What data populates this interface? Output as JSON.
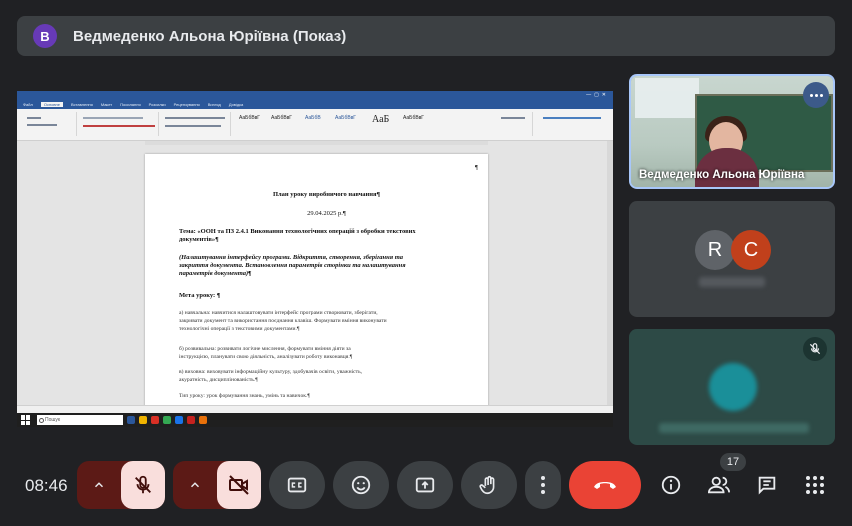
{
  "banner": {
    "avatar_letter": "В",
    "title": "Ведмеденко Альона Юріївна (Показ)"
  },
  "shared_screen": {
    "window_tabs": [
      "Файл",
      "Основне",
      "Вставлення",
      "Макет",
      "Посилання",
      "Розсилки",
      "Рецензування",
      "Вигляд",
      "Довідка"
    ],
    "style_samples": [
      "АаБбВвГ",
      "АаБбВвГ",
      "АаБбВ",
      "АаБбВвГ",
      "АаБбВвГ"
    ],
    "big_style": "АаБ",
    "search_placeholder": "Пошук",
    "document": {
      "corner_mark": "¶",
      "title": "План уроку виробничого навчання¶",
      "date": "29.04.2025 р.¶",
      "topic": "Тема: «ООН та ПЗ 2.4.1 Виконання технологічних операцій з обробки текстових документів»¶",
      "topic_line1": "Тема: «ООН та ПЗ 2.4.1 Виконання технологічних операцій з обробки текстових",
      "topic_line2": "документів»¶",
      "sub_line1": "(Налаштування інтерфейсу програми. Відкриття, створення, зберігання та",
      "sub_line2": "закриття документа. Встановлення параметрів сторінки та налаштування",
      "sub_line3": "параметрів документа)¶",
      "goal": "Мета уроку: ¶",
      "a_line1": "а) навчальна: навчитися налаштовувати інтерфейс програми створювати, зберігати,",
      "a_line2": "закривати документ та використання поєднання клавіш. Формувати вміння виконувати",
      "a_line3": "технологічні операції з текстовими документами.¶",
      "b_line1": "б) розвивальна: розвивати логічне мислення, формувати вміння діяти за",
      "b_line2": "інструкцією, планувати свою діяльність, аналізувати роботу виконавця.¶",
      "c_line1": "в) виховна: виховувати інформаційну культуру, здобувачів освіти, уважність,",
      "c_line2": "акуратність, дисциплінованість.¶",
      "type_line": "Тип уроку: урок формування знань, умінь та навичок.¶"
    }
  },
  "tiles": [
    {
      "name": "Ведмеденко Альона Юріївна"
    },
    {
      "initials": [
        "R",
        "C"
      ],
      "colors": [
        "#5f6368",
        "#c1401b"
      ]
    },
    {
      "mic": "muted"
    }
  ],
  "toolbar": {
    "time": "08:46",
    "participants_count": "17",
    "colors": {
      "danger": "#ea4335",
      "muted_bg": "#f9dedc",
      "group_bg": "#5c1a16"
    }
  }
}
